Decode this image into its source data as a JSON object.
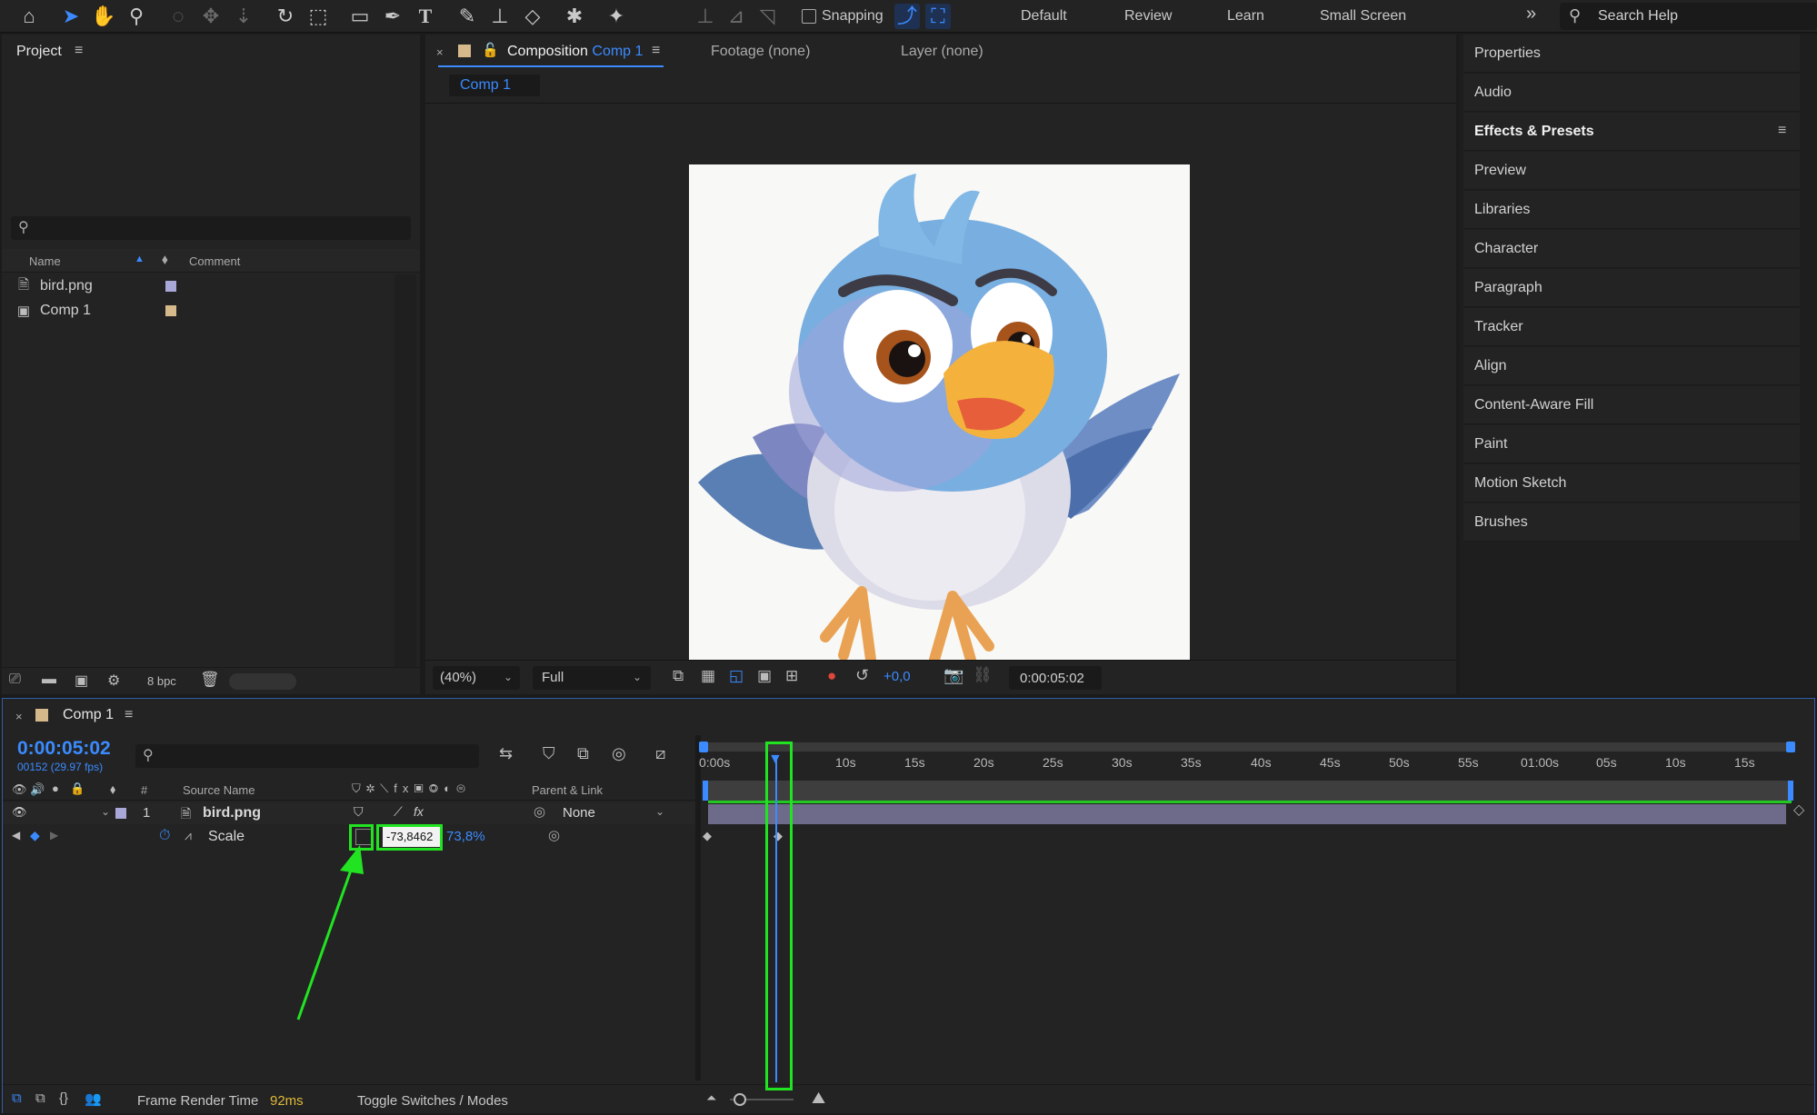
{
  "toolbar": {
    "snapping_label": "Snapping",
    "workspaces": [
      "Default",
      "Review",
      "Learn",
      "Small Screen"
    ],
    "more": "»",
    "search_help": "Search Help"
  },
  "project": {
    "title": "Project",
    "columns": {
      "name": "Name",
      "comment": "Comment"
    },
    "items": [
      {
        "name": "bird.png",
        "color": "#a9a6d8"
      },
      {
        "name": "Comp 1",
        "color": "#d6b98a"
      }
    ],
    "bpc": "8 bpc"
  },
  "viewer": {
    "tabs": {
      "composition_prefix": "Composition",
      "composition_name": "Comp 1",
      "footage": "Footage (none)",
      "layer": "Layer (none)"
    },
    "comp_tab": "Comp 1",
    "zoom": "(40%)",
    "resolution": "Full",
    "exposure": "+0,0",
    "timecode": "0:00:05:02"
  },
  "right_panel": {
    "items": [
      "Properties",
      "Audio",
      "Effects & Presets",
      "Preview",
      "Libraries",
      "Character",
      "Paragraph",
      "Tracker",
      "Align",
      "Content-Aware Fill",
      "Paint",
      "Motion Sketch",
      "Brushes"
    ]
  },
  "timeline": {
    "comp_name": "Comp 1",
    "timecode": "0:00:05:02",
    "frame_info": "00152 (29.97 fps)",
    "columns": {
      "num": "#",
      "source": "Source Name",
      "parent": "Parent & Link"
    },
    "layer": {
      "num": "1",
      "name": "bird.png",
      "parent": "None"
    },
    "property": {
      "name": "Scale",
      "value_editing": "-73,8462",
      "value_second": "73,8%"
    },
    "ruler": [
      "0:00s",
      "10s",
      "15s",
      "20s",
      "25s",
      "30s",
      "35s",
      "40s",
      "45s",
      "50s",
      "55s",
      "01:00s",
      "05s",
      "10s",
      "15s"
    ],
    "footer": {
      "render_label": "Frame Render Time",
      "render_value": "92ms",
      "toggle": "Toggle Switches / Modes"
    }
  },
  "colors": {
    "accent": "#3b8bff",
    "highlight": "#22e322",
    "panel": "#232323"
  }
}
